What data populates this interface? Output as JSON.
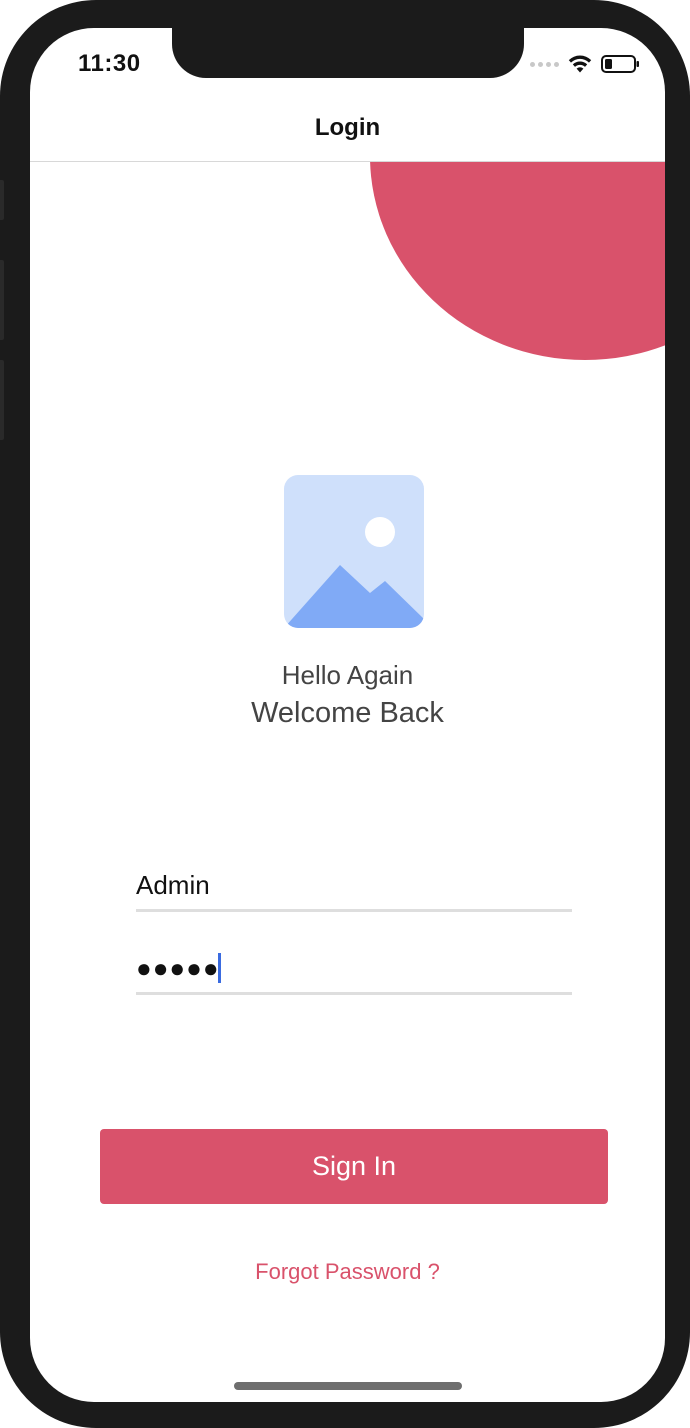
{
  "status_bar": {
    "time": "11:30",
    "icons": [
      "signal-dots-icon",
      "wifi-icon",
      "battery-icon"
    ]
  },
  "nav": {
    "title": "Login"
  },
  "logo": {
    "icon": "image-placeholder-icon"
  },
  "greeting": {
    "line1": "Hello Again",
    "line2": "Welcome Back"
  },
  "form": {
    "username_value": "Admin",
    "password_value": "●●●●●"
  },
  "actions": {
    "signin_label": "Sign In",
    "forgot_label": "Forgot Password ?"
  },
  "colors": {
    "accent": "#d9526b",
    "caret": "#3a6be0",
    "logo_bg": "#cfe0fb",
    "logo_mountain": "#80aaf6"
  }
}
